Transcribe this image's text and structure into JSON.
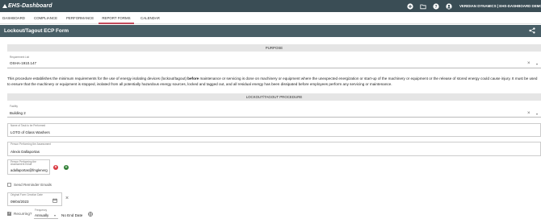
{
  "header": {
    "app_name": "EHS-Dashboard",
    "company": "VERIDIAN DYNAMICS | EHS-DASHBOARD DEMO",
    "icons": [
      "plus-circle-icon",
      "folder-icon",
      "help-icon",
      "user-icon"
    ]
  },
  "nav": {
    "tabs": [
      {
        "label": "DASHBOARD"
      },
      {
        "label": "COMPLIANCE"
      },
      {
        "label": "PERFORMANCE"
      },
      {
        "label": "REPORT FORMS"
      },
      {
        "label": "CALENDAR"
      }
    ],
    "active_tab": "REPORT FORMS"
  },
  "page": {
    "title": "Lockout/Tagout ECP Form"
  },
  "sections": {
    "purpose": "PURPOSE",
    "procedure": "LOCKOUT/TAGOUT PROCEDURE"
  },
  "requirement": {
    "label": "Requirement List",
    "value": "OSHA-1910.147"
  },
  "description": {
    "part1": "This procedure establishes the minimum requirements for the use of energy isolating devices (lockout/tagout) ",
    "bold": "before",
    "part2": " maintenance or servicing is done on machinery or equipment where the unexpected energization or start-up of the machinery or equipment or the release of stored energy could cause injury. It must be used to ensure that the machinery or equipment is stopped, isolated from all potentially hazardous energy sources, locked and tagged out, and all residual energy has been dissipated before employees perform any servicing or maintenance."
  },
  "facility": {
    "label": "Facility",
    "value": "Building 2"
  },
  "task": {
    "label": "Name of Task to be Performed",
    "value": "LOTO of Glass Washers"
  },
  "person": {
    "label": "Person Performing the Assessment",
    "value": "Alexis Dallaportas"
  },
  "email": {
    "label": "Person Performing the Assessment Email",
    "value": "adallaportas@fmglenerg"
  },
  "reminder": {
    "label": "Send Reminder Emails",
    "checked": false
  },
  "creation_date": {
    "label": "Original Form Creation Date",
    "value": "09/04/2023"
  },
  "recurring": {
    "label": "Recurring?",
    "checked": true,
    "frequency_label": "Frequency",
    "frequency_value": "Annually",
    "end_date": "No End Date"
  },
  "colors": {
    "header_bg": "#3a4d55",
    "title_bg": "#485e66",
    "active_tab_underline": "#c34a5c",
    "remove_button": "#d9363e",
    "add_button": "#2e7d32"
  }
}
